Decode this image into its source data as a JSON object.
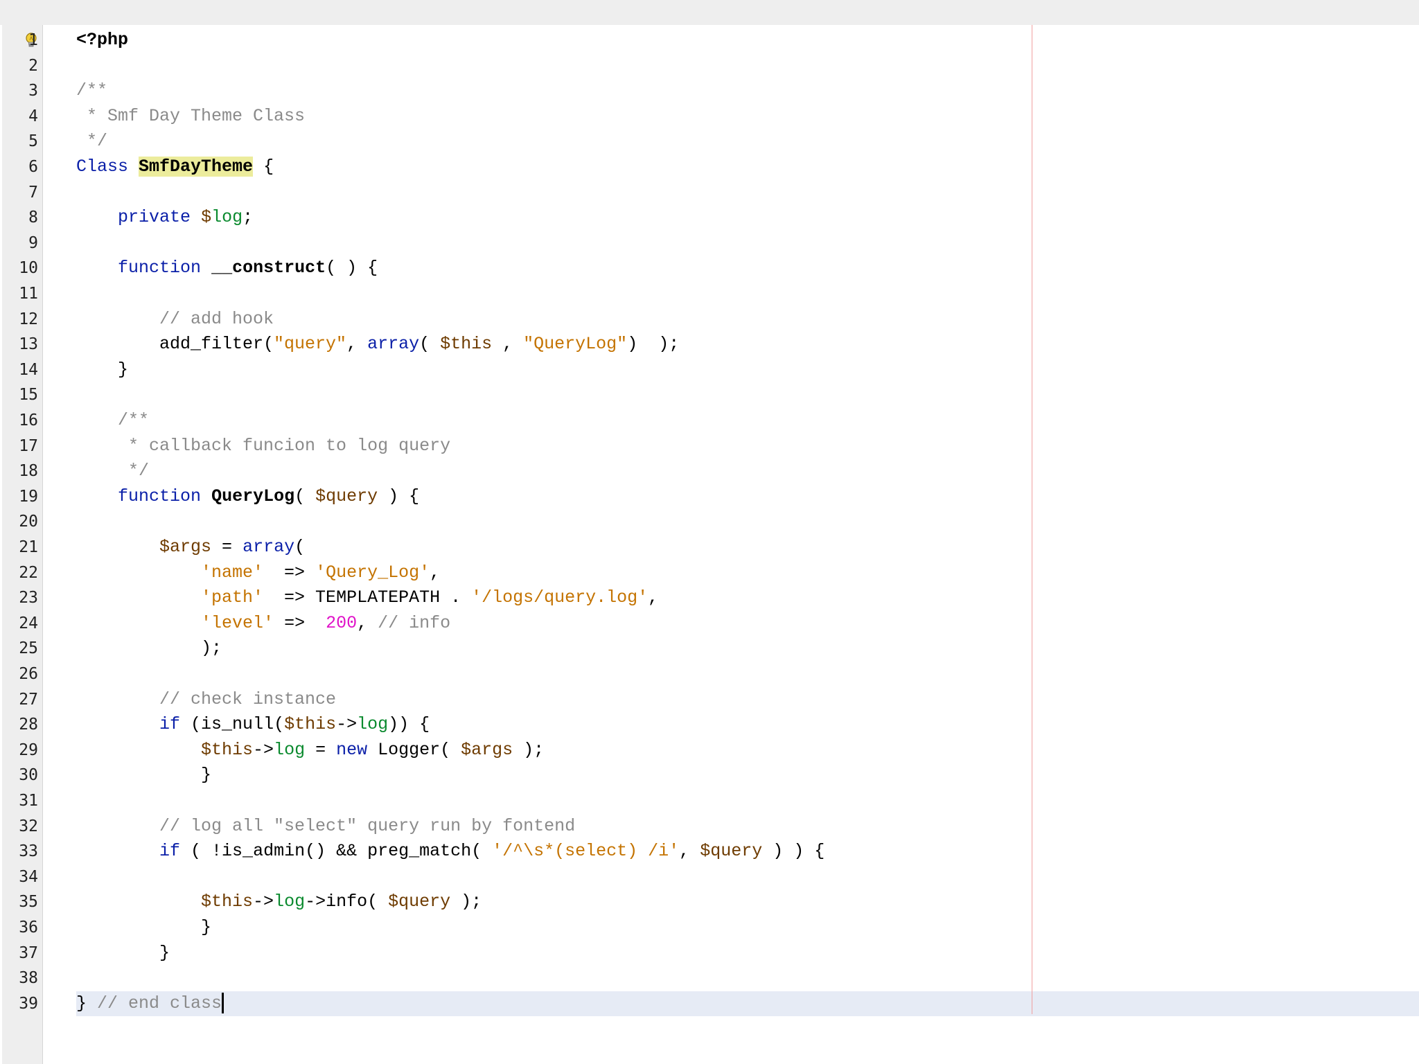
{
  "editor": {
    "colors": {
      "keyword": "#0a1fa8",
      "string": "#c47300",
      "comment": "#8a8a8a",
      "number": "#e012c8",
      "field": "#0a8a2e",
      "class_highlight": "#ecec9c",
      "current_line": "#e6ebf5",
      "margin_line": "#f0a0a0",
      "gutter_bg": "#eeeeee"
    },
    "gutter_icon": "lightbulb-icon",
    "lines": [
      {
        "n": "1",
        "tokens": [
          {
            "t": "<?php",
            "c": "fn"
          }
        ]
      },
      {
        "n": "2",
        "tokens": []
      },
      {
        "n": "3",
        "tokens": [
          {
            "t": "/**",
            "c": "comment"
          }
        ]
      },
      {
        "n": "4",
        "tokens": [
          {
            "t": " * Smf Day Theme Class",
            "c": "comment"
          }
        ]
      },
      {
        "n": "5",
        "tokens": [
          {
            "t": " */",
            "c": "comment"
          }
        ]
      },
      {
        "n": "6",
        "tokens": [
          {
            "t": "Class",
            "c": "keyword"
          },
          {
            "t": " ",
            "c": "plain"
          },
          {
            "t": "SmfDayTheme",
            "c": "classname"
          },
          {
            "t": " {",
            "c": "plain"
          }
        ]
      },
      {
        "n": "7",
        "tokens": []
      },
      {
        "n": "8",
        "tokens": [
          {
            "t": "    ",
            "c": "plain"
          },
          {
            "t": "private",
            "c": "keyword"
          },
          {
            "t": " ",
            "c": "plain"
          },
          {
            "t": "$",
            "c": "var"
          },
          {
            "t": "log",
            "c": "field"
          },
          {
            "t": ";",
            "c": "plain"
          }
        ]
      },
      {
        "n": "9",
        "tokens": []
      },
      {
        "n": "10",
        "tokens": [
          {
            "t": "    ",
            "c": "plain"
          },
          {
            "t": "function",
            "c": "keyword"
          },
          {
            "t": " ",
            "c": "plain"
          },
          {
            "t": "__construct",
            "c": "fn"
          },
          {
            "t": "( ) {",
            "c": "plain"
          }
        ]
      },
      {
        "n": "11",
        "tokens": []
      },
      {
        "n": "12",
        "tokens": [
          {
            "t": "        // add hook",
            "c": "comment"
          }
        ]
      },
      {
        "n": "13",
        "tokens": [
          {
            "t": "        add_filter(",
            "c": "plain"
          },
          {
            "t": "\"query\"",
            "c": "string"
          },
          {
            "t": ", ",
            "c": "plain"
          },
          {
            "t": "array",
            "c": "keyword"
          },
          {
            "t": "( ",
            "c": "plain"
          },
          {
            "t": "$this",
            "c": "var"
          },
          {
            "t": " , ",
            "c": "plain"
          },
          {
            "t": "\"QueryLog\"",
            "c": "string"
          },
          {
            "t": ")  );",
            "c": "plain"
          }
        ]
      },
      {
        "n": "14",
        "tokens": [
          {
            "t": "    }",
            "c": "plain"
          }
        ]
      },
      {
        "n": "15",
        "tokens": []
      },
      {
        "n": "16",
        "tokens": [
          {
            "t": "    /**",
            "c": "comment"
          }
        ]
      },
      {
        "n": "17",
        "tokens": [
          {
            "t": "     * callback funcion to log query",
            "c": "comment"
          }
        ]
      },
      {
        "n": "18",
        "tokens": [
          {
            "t": "     */",
            "c": "comment"
          }
        ]
      },
      {
        "n": "19",
        "tokens": [
          {
            "t": "    ",
            "c": "plain"
          },
          {
            "t": "function",
            "c": "keyword"
          },
          {
            "t": " ",
            "c": "plain"
          },
          {
            "t": "QueryLog",
            "c": "fn"
          },
          {
            "t": "( ",
            "c": "plain"
          },
          {
            "t": "$query",
            "c": "var"
          },
          {
            "t": " ) {",
            "c": "plain"
          }
        ]
      },
      {
        "n": "20",
        "tokens": []
      },
      {
        "n": "21",
        "tokens": [
          {
            "t": "        ",
            "c": "plain"
          },
          {
            "t": "$args",
            "c": "var"
          },
          {
            "t": " = ",
            "c": "plain"
          },
          {
            "t": "array",
            "c": "keyword"
          },
          {
            "t": "(",
            "c": "plain"
          }
        ]
      },
      {
        "n": "22",
        "tokens": [
          {
            "t": "            ",
            "c": "plain"
          },
          {
            "t": "'name'",
            "c": "string"
          },
          {
            "t": "  => ",
            "c": "plain"
          },
          {
            "t": "'Query_Log'",
            "c": "string"
          },
          {
            "t": ",",
            "c": "plain"
          }
        ]
      },
      {
        "n": "23",
        "tokens": [
          {
            "t": "            ",
            "c": "plain"
          },
          {
            "t": "'path'",
            "c": "string"
          },
          {
            "t": "  => TEMPLATEPATH . ",
            "c": "plain"
          },
          {
            "t": "'/logs/query.log'",
            "c": "string"
          },
          {
            "t": ",",
            "c": "plain"
          }
        ]
      },
      {
        "n": "24",
        "tokens": [
          {
            "t": "            ",
            "c": "plain"
          },
          {
            "t": "'level'",
            "c": "string"
          },
          {
            "t": " =>  ",
            "c": "plain"
          },
          {
            "t": "200",
            "c": "number"
          },
          {
            "t": ", ",
            "c": "plain"
          },
          {
            "t": "// info",
            "c": "comment"
          }
        ]
      },
      {
        "n": "25",
        "tokens": [
          {
            "t": "            );",
            "c": "plain"
          }
        ]
      },
      {
        "n": "26",
        "tokens": []
      },
      {
        "n": "27",
        "tokens": [
          {
            "t": "        // check instance",
            "c": "comment"
          }
        ]
      },
      {
        "n": "28",
        "tokens": [
          {
            "t": "        ",
            "c": "plain"
          },
          {
            "t": "if",
            "c": "keyword"
          },
          {
            "t": " (is_null(",
            "c": "plain"
          },
          {
            "t": "$this",
            "c": "var"
          },
          {
            "t": "->",
            "c": "plain"
          },
          {
            "t": "log",
            "c": "field"
          },
          {
            "t": ")) {",
            "c": "plain"
          }
        ]
      },
      {
        "n": "29",
        "tokens": [
          {
            "t": "            ",
            "c": "plain"
          },
          {
            "t": "$this",
            "c": "var"
          },
          {
            "t": "->",
            "c": "plain"
          },
          {
            "t": "log",
            "c": "field"
          },
          {
            "t": " = ",
            "c": "plain"
          },
          {
            "t": "new",
            "c": "keyword"
          },
          {
            "t": " Logger( ",
            "c": "plain"
          },
          {
            "t": "$args",
            "c": "var"
          },
          {
            "t": " );",
            "c": "plain"
          }
        ]
      },
      {
        "n": "30",
        "tokens": [
          {
            "t": "            }",
            "c": "plain"
          }
        ]
      },
      {
        "n": "31",
        "tokens": []
      },
      {
        "n": "32",
        "tokens": [
          {
            "t": "        // log all \"select\" query run by fontend",
            "c": "comment"
          }
        ]
      },
      {
        "n": "33",
        "tokens": [
          {
            "t": "        ",
            "c": "plain"
          },
          {
            "t": "if",
            "c": "keyword"
          },
          {
            "t": " ( !is_admin() && preg_match( ",
            "c": "plain"
          },
          {
            "t": "'/^\\s*(select) /i'",
            "c": "string"
          },
          {
            "t": ", ",
            "c": "plain"
          },
          {
            "t": "$query",
            "c": "var"
          },
          {
            "t": " ) ) {",
            "c": "plain"
          }
        ]
      },
      {
        "n": "34",
        "tokens": []
      },
      {
        "n": "35",
        "tokens": [
          {
            "t": "            ",
            "c": "plain"
          },
          {
            "t": "$this",
            "c": "var"
          },
          {
            "t": "->",
            "c": "plain"
          },
          {
            "t": "log",
            "c": "field"
          },
          {
            "t": "->info( ",
            "c": "plain"
          },
          {
            "t": "$query",
            "c": "var"
          },
          {
            "t": " );",
            "c": "plain"
          }
        ]
      },
      {
        "n": "36",
        "tokens": [
          {
            "t": "            }",
            "c": "plain"
          }
        ]
      },
      {
        "n": "37",
        "tokens": [
          {
            "t": "        }",
            "c": "plain"
          }
        ]
      },
      {
        "n": "38",
        "tokens": []
      },
      {
        "n": "39",
        "tokens": [
          {
            "t": "} ",
            "c": "plain"
          },
          {
            "t": "// end class",
            "c": "comment"
          }
        ]
      }
    ],
    "current_line": 39
  }
}
